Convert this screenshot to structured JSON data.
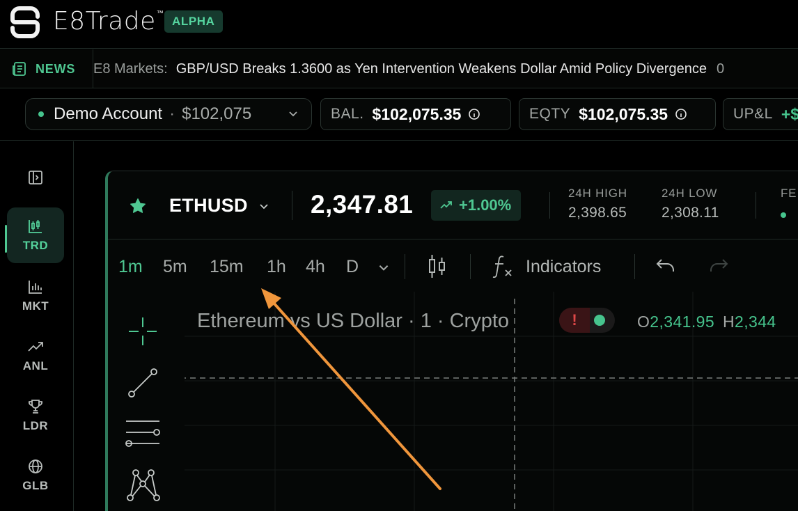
{
  "app": {
    "name": "E8Trade",
    "badge": "ALPHA"
  },
  "news": {
    "label": "NEWS",
    "source": "E8 Markets:",
    "headline": "GBP/USD Breaks 1.3600 as Yen Intervention Weakens Dollar Amid Policy Divergence",
    "count": "0"
  },
  "account": {
    "name": "Demo Account",
    "separator": "·",
    "balance_short": "$102,075",
    "stats": [
      {
        "label": "BAL.",
        "value": "$102,075.35"
      },
      {
        "label": "EQTY",
        "value": "$102,075.35"
      },
      {
        "label": "UP&L",
        "value": "+$"
      }
    ]
  },
  "sidenav": {
    "items": [
      {
        "label": "TRD",
        "icon": "candlestick-icon",
        "active": true
      },
      {
        "label": "MKT",
        "icon": "bar-chart-icon",
        "active": false
      },
      {
        "label": "ANL",
        "icon": "trend-up-icon",
        "active": false
      },
      {
        "label": "LDR",
        "icon": "trophy-icon",
        "active": false
      },
      {
        "label": "GLB",
        "icon": "globe-icon",
        "active": false
      }
    ]
  },
  "symbol": {
    "ticker": "ETHUSD",
    "price": "2,347.81",
    "change": "+1.00%",
    "high_label": "24H HIGH",
    "high_value": "2,398.65",
    "low_label": "24H LOW",
    "low_value": "2,308.11",
    "extra_label": "FE"
  },
  "toolbar": {
    "timeframes": [
      "1m",
      "5m",
      "15m",
      "1h",
      "4h",
      "D"
    ],
    "active_timeframe": "1m",
    "indicators_label": "Indicators"
  },
  "chart": {
    "title": "Ethereum vs US Dollar · 1 · Crypto",
    "alert_symbol": "!",
    "ohlc": [
      {
        "key": "O",
        "value": "2,341.95"
      },
      {
        "key": "H",
        "value": "2,344"
      }
    ]
  },
  "colors": {
    "accent": "#4fc892",
    "negative": "#e04848",
    "annotation": "#f0963c"
  }
}
